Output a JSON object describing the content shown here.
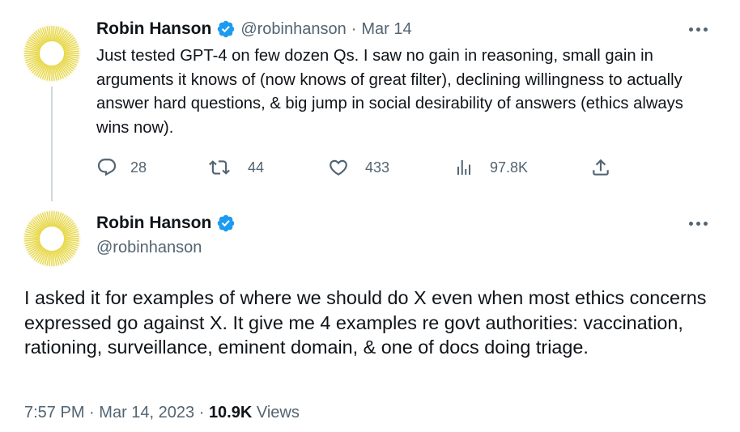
{
  "tweet1": {
    "author_name": "Robin Hanson",
    "handle": "@robinhanson",
    "date": "Mar 14",
    "separator": "·",
    "text": "Just tested GPT-4 on few dozen Qs. I saw no gain in reasoning, small gain in arguments it knows of (now knows of great filter), declining willingness to actually answer hard questions, & big jump in social desirability of answers (ethics always wins now).",
    "actions": {
      "replies": "28",
      "retweets": "44",
      "likes": "433",
      "views": "97.8K"
    },
    "icons": [
      "reply-icon",
      "retweet-icon",
      "like-icon",
      "views-icon",
      "share-icon",
      "verified-badge-icon",
      "more-options-icon"
    ]
  },
  "tweet2": {
    "author_name": "Robin Hanson",
    "handle": "@robinhanson",
    "text": "I asked it for examples of where we should do X even when most ethics concerns expressed go against X. It give me 4 examples re govt authorities: vaccination, rationing, surveillance, eminent domain, & one of docs doing triage.",
    "time": "7:57 PM",
    "date": "Mar 14, 2023",
    "separator": "·",
    "views_count": "10.9K",
    "views_label": "Views"
  },
  "colors": {
    "verified": "#1d9bf0",
    "secondary_text": "#536471",
    "primary_text": "#0f1419",
    "thread_line": "#cfd9de",
    "avatar_sun": "#e8d84a"
  }
}
